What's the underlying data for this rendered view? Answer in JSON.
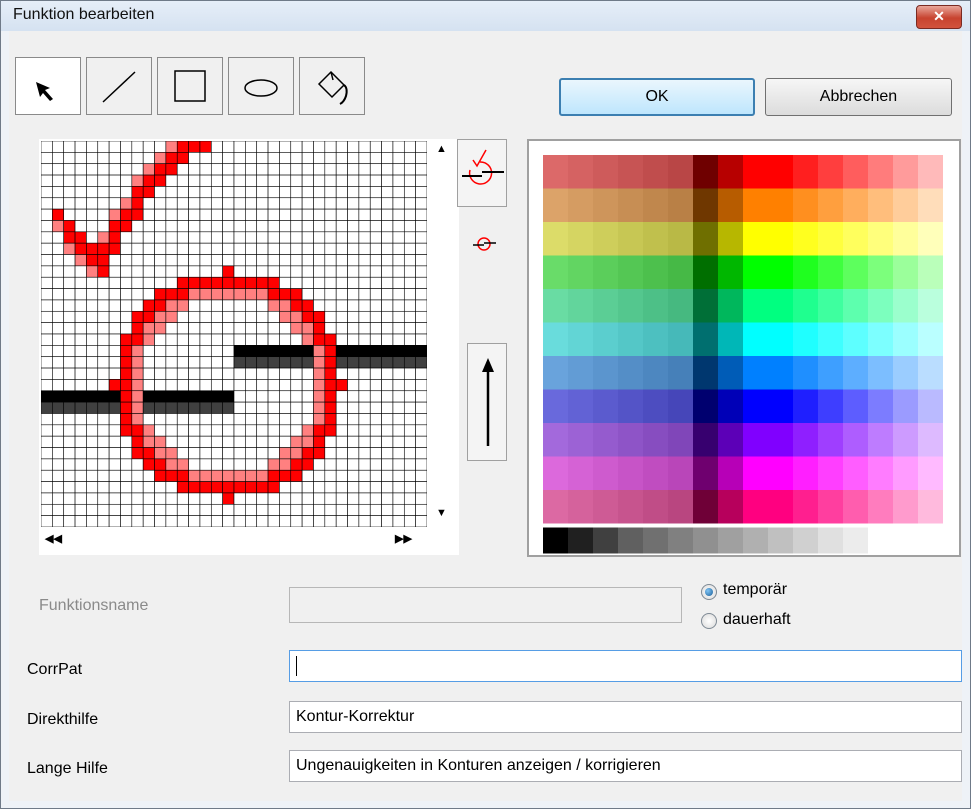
{
  "window": {
    "title": "Funktion bearbeiten",
    "close_glyph": "✕"
  },
  "toolbar": {
    "tools": [
      {
        "name": "pointer-tool",
        "icon": "arrow-pointer-icon",
        "active": true
      },
      {
        "name": "line-tool",
        "icon": "line-icon",
        "active": false
      },
      {
        "name": "rectangle-tool",
        "icon": "rectangle-icon",
        "active": false
      },
      {
        "name": "ellipse-tool",
        "icon": "ellipse-icon",
        "active": false
      },
      {
        "name": "fill-tool",
        "icon": "paint-bucket-icon",
        "active": false
      }
    ]
  },
  "buttons": {
    "ok": "OK",
    "cancel": "Abbrechen"
  },
  "icon_editor": {
    "grid_cols": 34,
    "grid_rows": 34,
    "colors": {
      "red": "#ff0000",
      "light_red": "#ff8080",
      "black": "#000000",
      "dark_gray": "#404040"
    },
    "scroll_glyphs": {
      "up": "▲",
      "down": "▼",
      "left": "◀◀",
      "right": "▶▶"
    }
  },
  "side_buttons": [
    {
      "name": "preview-large",
      "icon": "contour-correction-icon"
    },
    {
      "name": "preview-small",
      "icon": "contour-correction-small-icon"
    },
    {
      "name": "direction",
      "icon": "arrow-up-icon"
    }
  ],
  "palette": {
    "hue_columns": [
      "#ff0000",
      "#ff8000",
      "#ffff00",
      "#00ff00",
      "#00ff80",
      "#00ffff",
      "#0080ff",
      "#0000ff",
      "#8000ff",
      "#ff00ff",
      "#ff0080"
    ],
    "gray_steps": [
      "#000000",
      "#202020",
      "#404040",
      "#606060",
      "#707070",
      "#808080",
      "#909090",
      "#a0a0a0",
      "#b0b0b0",
      "#c0c0c0",
      "#d0d0d0",
      "#e0e0e0",
      "#ececec",
      "#ffffff",
      "#ffffff",
      "#ffffff"
    ]
  },
  "form": {
    "funktionsname_label": "Funktionsname",
    "funktionsname_value": "",
    "mode_temp": "temporär",
    "mode_perm": "dauerhaft",
    "mode_selected": "temporär",
    "corrpat_label": "CorrPat",
    "corrpat_value": "",
    "direkthilfe_label": "Direkthilfe",
    "direkthilfe_value": "Kontur-Korrektur",
    "langehilfe_label": "Lange Hilfe",
    "langehilfe_value": "Ungenauigkeiten in Konturen anzeigen / korrigieren"
  }
}
